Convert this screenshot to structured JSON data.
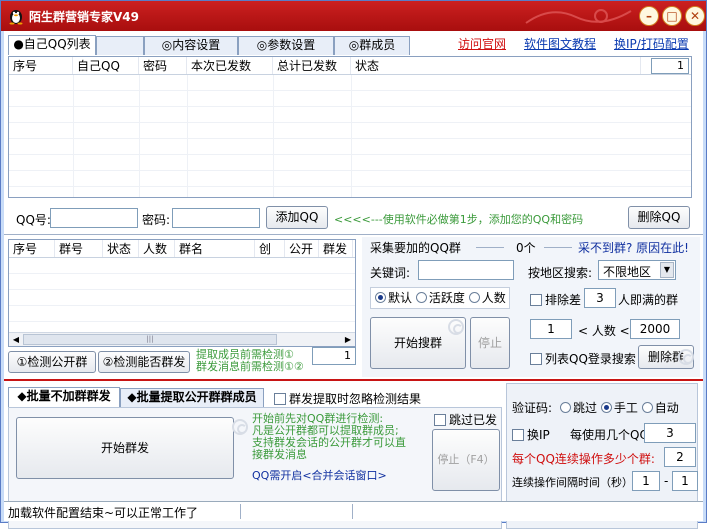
{
  "window": {
    "title": "陌生群营销专家V49"
  },
  "tabs_top": [
    "●自己QQ列表",
    "",
    "◎内容设置",
    "◎参数设置",
    "◎群成员"
  ],
  "top_links": {
    "official": "访问官网",
    "tutorial": "软件图文教程",
    "ip_config": "换IP/打码配置"
  },
  "qq_table": {
    "columns": [
      "序号",
      "自己QQ",
      "密码",
      "本次已发数",
      "总计已发数",
      "状态"
    ],
    "page_value": "1"
  },
  "qq_form": {
    "qq_label": "QQ号:",
    "pwd_label": "密码:",
    "add_button": "添加QQ",
    "hint": "<<<<---使用软件必做第1步，添加您的QQ和密码",
    "delete_button": "删除QQ"
  },
  "group_table": {
    "columns": [
      "序号",
      "群号",
      "状态",
      "人数",
      "群名",
      "创",
      "公开",
      "群发"
    ],
    "scroll_glyph": "|||"
  },
  "group_actions": {
    "check_public": "①检测公开群",
    "check_sendable": "②检测能否群发",
    "note": "提取成员前需检测①\n群发消息前需检测①②",
    "count_value": "1"
  },
  "collect": {
    "title": "采集要加的QQ群",
    "count": "0个",
    "not_found_link": "采不到群? 原因在此!",
    "keyword_label": "关键词:",
    "region_label": "按地区搜索:",
    "region_value": "不限地区",
    "sort_options": [
      "默认",
      "活跃度",
      "人数"
    ],
    "sort_selected": 0,
    "exclude_label": "排除差",
    "exclude_value": "3",
    "exclude_suffix": "人即满的群",
    "start_search": "开始搜群",
    "stop": "停止",
    "min_members": "1",
    "people_label": "< 人数 <",
    "max_members": "2000",
    "list_qq_label": "列表QQ登录搜索",
    "delete_groups": "删除群"
  },
  "tabs_bottom": [
    "◆批量不加群群发",
    "◆批量提取公开群群成员"
  ],
  "ignore_check_label": "群发提取时忽略检测结果",
  "send": {
    "start_button": "开始群发",
    "note": "开始前先对QQ群进行检测:\n凡是公开群都可以提取群成员;\n支持群发会话的公开群才可以直\n接群发消息",
    "session_link": "QQ需开启<合并会话窗口>",
    "skip_sent_label": "跳过已发",
    "stop_button": "停止（F4）"
  },
  "captcha": {
    "label": "验证码:",
    "options": [
      "跳过",
      "手工",
      "自动"
    ],
    "selected": 1,
    "change_ip_label": "换IP",
    "per_qq_label": "每使用几个QQ:",
    "per_qq_value": "3",
    "consecutive_label": "每个QQ连续操作多少个群:",
    "consecutive_value": "2",
    "interval_label": "连续操作间隔时间（秒）",
    "interval_from": "1",
    "interval_sep": "-",
    "interval_to": "1"
  },
  "status": {
    "text": "加载软件配置结束~可以正常工作了"
  },
  "colors": {
    "title_bar": "#b81414",
    "window_bg": "#c8dcf8",
    "link_blue": "#0a3ab0",
    "link_red": "#d01010",
    "hint_green": "#3a9a3a"
  }
}
